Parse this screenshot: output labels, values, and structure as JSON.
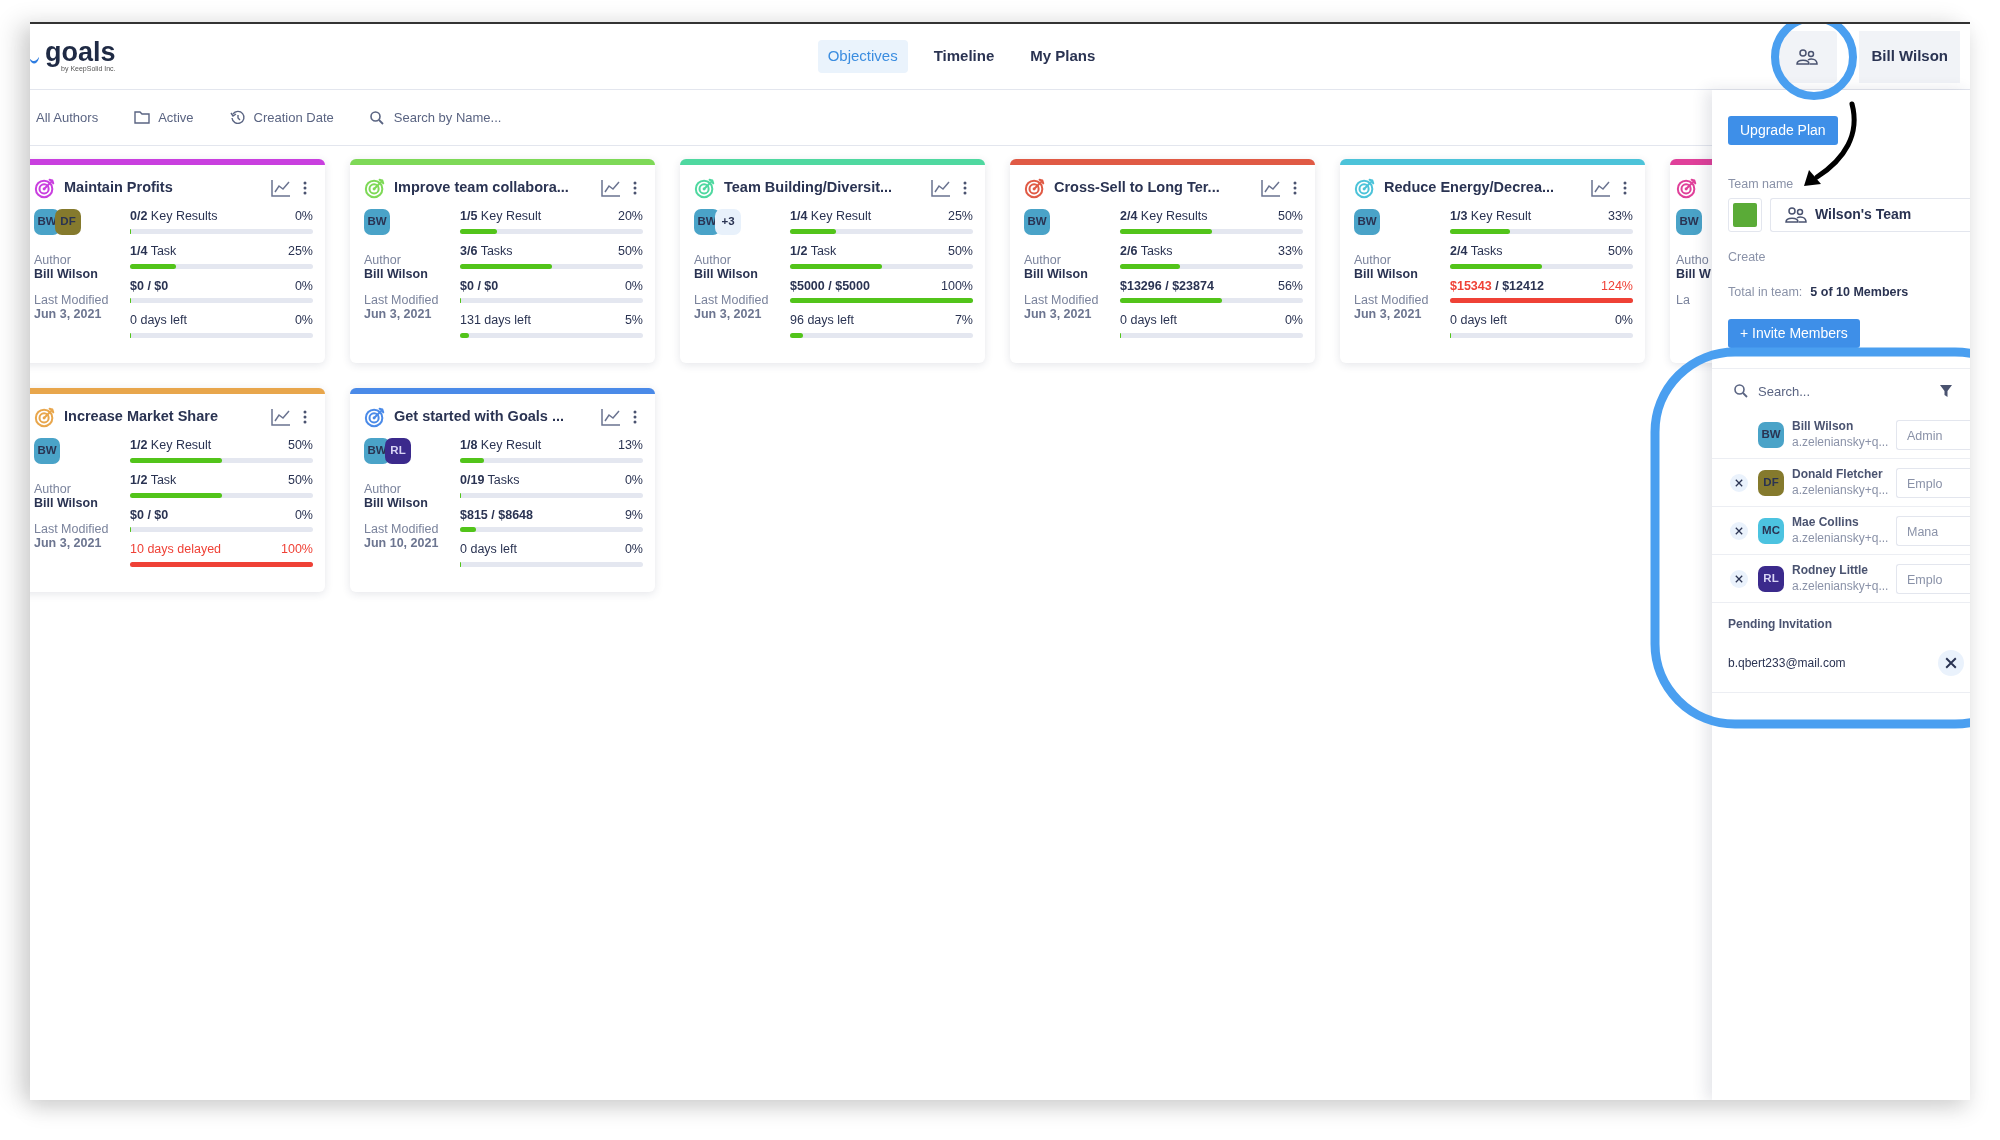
{
  "app": {
    "logo": "goals",
    "logo_sub": "by KeepSolid Inc."
  },
  "nav_tabs": [
    {
      "label": "Objectives",
      "selected": true
    },
    {
      "label": "Timeline",
      "selected": false
    },
    {
      "label": "My Plans",
      "selected": false
    }
  ],
  "user": {
    "name": "Bill Wilson"
  },
  "filters": [
    {
      "kind": "text",
      "label": "All Authors"
    },
    {
      "kind": "folder",
      "label": "Active"
    },
    {
      "kind": "history",
      "label": "Creation Date"
    }
  ],
  "search": {
    "placeholder": "Search by Name..."
  },
  "objectives": [
    {
      "title": "Maintain Profits",
      "color": "#c93fdf",
      "avatars": [
        {
          "initials": "BW",
          "color": "#4aa3c8"
        },
        {
          "initials": "DF",
          "color": "#857a2d"
        }
      ],
      "author_label": "Author",
      "author": "Bill Wilson",
      "modified_label": "Last Modified",
      "modified": "Jun 3, 2021",
      "metrics": [
        {
          "kind": "count",
          "count": "0/2",
          "text": "Key Results",
          "pct": "0%",
          "level": 0,
          "alert": false
        },
        {
          "kind": "count",
          "count": "1/4",
          "text": "Task",
          "pct": "25%",
          "level": 0.25,
          "alert": false
        },
        {
          "kind": "money",
          "actual": "$0",
          "rest": " / $0",
          "pct": "0%",
          "level": 0,
          "alert": false
        },
        {
          "kind": "days",
          "text": "0 days left",
          "pct": "0%",
          "level": 0,
          "alert": false
        }
      ]
    },
    {
      "title": "Improve team collabora...",
      "color": "#7ed957",
      "avatars": [
        {
          "initials": "BW",
          "color": "#4aa3c8"
        }
      ],
      "author_label": "Author",
      "author": "Bill Wilson",
      "modified_label": "Last Modified",
      "modified": "Jun 3, 2021",
      "metrics": [
        {
          "kind": "count",
          "count": "1/5",
          "text": "Key Result",
          "pct": "20%",
          "level": 0.2,
          "alert": false
        },
        {
          "kind": "count",
          "count": "3/6",
          "text": "Tasks",
          "pct": "50%",
          "level": 0.5,
          "alert": false
        },
        {
          "kind": "money",
          "actual": "$0",
          "rest": " / $0",
          "pct": "0%",
          "level": 0,
          "alert": false
        },
        {
          "kind": "days",
          "text": "131 days left",
          "pct": "5%",
          "level": 0.05,
          "alert": false
        }
      ]
    },
    {
      "title": "Team Building/Diversit...",
      "color": "#4fd8a0",
      "avatars": [
        {
          "initials": "BW",
          "color": "#4aa3c8"
        },
        {
          "initials": "+3",
          "color": "#e8f1fb"
        }
      ],
      "author_label": "Author",
      "author": "Bill Wilson",
      "modified_label": "Last Modified",
      "modified": "Jun 3, 2021",
      "metrics": [
        {
          "kind": "count",
          "count": "1/4",
          "text": "Key Result",
          "pct": "25%",
          "level": 0.25,
          "alert": false
        },
        {
          "kind": "count",
          "count": "1/2",
          "text": "Task",
          "pct": "50%",
          "level": 0.5,
          "alert": false
        },
        {
          "kind": "money",
          "actual": "$5000",
          "rest": " / $5000",
          "pct": "100%",
          "level": 1,
          "alert": false
        },
        {
          "kind": "days",
          "text": "96 days left",
          "pct": "7%",
          "level": 0.07,
          "alert": false
        }
      ]
    },
    {
      "title": "Cross-Sell to Long Ter...",
      "color": "#e05a45",
      "avatars": [
        {
          "initials": "BW",
          "color": "#4aa3c8"
        }
      ],
      "author_label": "Author",
      "author": "Bill Wilson",
      "modified_label": "Last Modified",
      "modified": "Jun 3, 2021",
      "metrics": [
        {
          "kind": "count",
          "count": "2/4",
          "text": "Key Results",
          "pct": "50%",
          "level": 0.5,
          "alert": false
        },
        {
          "kind": "count",
          "count": "2/6",
          "text": "Tasks",
          "pct": "33%",
          "level": 0.33,
          "alert": false
        },
        {
          "kind": "money",
          "actual": "$13296",
          "rest": " / $23874",
          "pct": "56%",
          "level": 0.56,
          "alert": false
        },
        {
          "kind": "days",
          "text": "0 days left",
          "pct": "0%",
          "level": 0,
          "alert": false
        }
      ]
    },
    {
      "title": "Reduce Energy/Decrea...",
      "color": "#4cc3d9",
      "avatars": [
        {
          "initials": "BW",
          "color": "#4aa3c8"
        }
      ],
      "author_label": "Author",
      "author": "Bill Wilson",
      "modified_label": "Last Modified",
      "modified": "Jun 3, 2021",
      "metrics": [
        {
          "kind": "count",
          "count": "1/3",
          "text": "Key Result",
          "pct": "33%",
          "level": 0.33,
          "alert": false
        },
        {
          "kind": "count",
          "count": "2/4",
          "text": "Tasks",
          "pct": "50%",
          "level": 0.5,
          "alert": false
        },
        {
          "kind": "money",
          "actual": "$15343",
          "rest": " / $12412",
          "pct": "124%",
          "level": 1,
          "alert": true
        },
        {
          "kind": "days",
          "text": "0 days left",
          "pct": "0%",
          "level": 0,
          "alert": false
        }
      ]
    },
    {
      "title": "Increase Market Share",
      "color": "#e8a64c",
      "avatars": [
        {
          "initials": "BW",
          "color": "#4aa3c8"
        }
      ],
      "author_label": "Author",
      "author": "Bill Wilson",
      "modified_label": "Last Modified",
      "modified": "Jun 3, 2021",
      "metrics": [
        {
          "kind": "count",
          "count": "1/2",
          "text": "Key Result",
          "pct": "50%",
          "level": 0.5,
          "alert": false
        },
        {
          "kind": "count",
          "count": "1/2",
          "text": "Task",
          "pct": "50%",
          "level": 0.5,
          "alert": false
        },
        {
          "kind": "money",
          "actual": "$0",
          "rest": " / $0",
          "pct": "0%",
          "level": 0,
          "alert": false
        },
        {
          "kind": "days",
          "text": "10 days delayed",
          "pct": "100%",
          "level": 1,
          "alert": true
        }
      ]
    },
    {
      "title": "Get started with Goals ...",
      "color": "#4a8ae8",
      "avatars": [
        {
          "initials": "BW",
          "color": "#4aa3c8"
        },
        {
          "initials": "RL",
          "color": "#3b2a8c"
        }
      ],
      "author_label": "Author",
      "author": "Bill Wilson",
      "modified_label": "Last Modified",
      "modified": "Jun 10, 2021",
      "metrics": [
        {
          "kind": "count",
          "count": "1/8",
          "text": "Key Result",
          "pct": "13%",
          "level": 0.13,
          "alert": false
        },
        {
          "kind": "count",
          "count": "0/19",
          "text": "Tasks",
          "pct": "0%",
          "level": 0,
          "alert": false
        },
        {
          "kind": "money",
          "actual": "$815",
          "rest": " / $8648",
          "pct": "9%",
          "level": 0.09,
          "alert": false
        },
        {
          "kind": "days",
          "text": "0 days left",
          "pct": "0%",
          "level": 0,
          "alert": false
        }
      ]
    }
  ],
  "partial_objective": {
    "color": "#e0409a",
    "avatars": [
      {
        "initials": "BW",
        "color": "#4aa3c8"
      }
    ],
    "author_label": "Autho",
    "author": "Bill W",
    "modified_label": "La"
  },
  "team_panel": {
    "upgrade": "Upgrade Plan",
    "team_label": "Team name",
    "team_name": "Wilson's Team",
    "created_label": "Create",
    "total_label": "Total in team:",
    "total": "5 of 10 Members",
    "invite": "+ Invite Members",
    "search_placeholder": "Search...",
    "members": [
      {
        "name": "Bill Wilson",
        "email": "a.zeleniansky+q...",
        "initials": "BW",
        "color": "#4aa3c8",
        "role": "Admin",
        "removable": false
      },
      {
        "name": "Donald Fletcher",
        "email": "a.zeleniansky+q...",
        "initials": "DF",
        "color": "#857a2d",
        "role": "Emplo",
        "removable": true
      },
      {
        "name": "Mae Collins",
        "email": "a.zeleniansky+q...",
        "initials": "MC",
        "color": "#4cc3e0",
        "role": "Mana",
        "removable": true
      },
      {
        "name": "Rodney Little",
        "email": "a.zeleniansky+q...",
        "initials": "RL",
        "color": "#3b2a8c",
        "role": "Emplo",
        "removable": true
      }
    ],
    "pending_label": "Pending Invitation",
    "pending": [
      {
        "email": "b.qbert233@mail.com"
      }
    ]
  }
}
